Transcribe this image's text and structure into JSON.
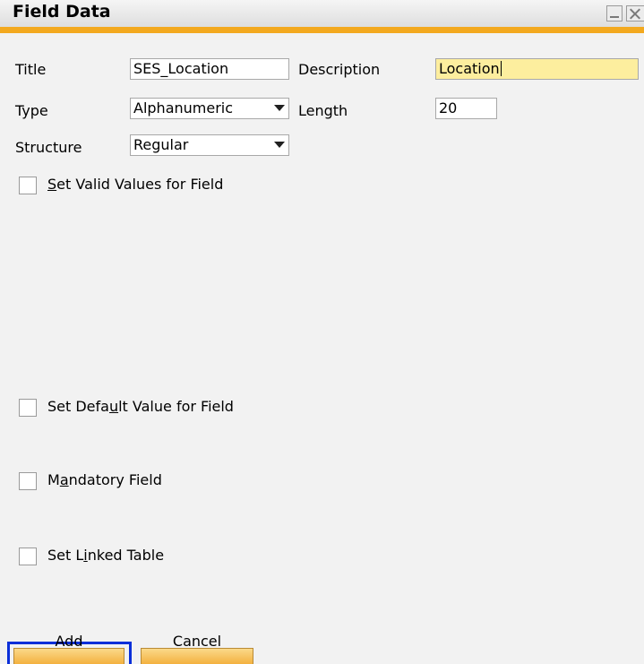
{
  "window": {
    "title": "Field Data",
    "accent_color": "#f3a91f"
  },
  "form": {
    "title_label": "Title",
    "title_value": "SES_Location",
    "description_label": "Description",
    "description_value": "Location",
    "type_label": "Type",
    "type_value": "Alphanumeric",
    "length_label": "Length",
    "length_value": "20",
    "structure_label": "Structure",
    "structure_value": "Regular"
  },
  "options": {
    "valid_values": {
      "pre": "",
      "mnemonic": "S",
      "post": "et Valid Values for Field",
      "checked": false
    },
    "default_value": {
      "pre": "Set Defa",
      "mnemonic": "u",
      "post": "lt Value for Field",
      "checked": false
    },
    "mandatory": {
      "pre": "M",
      "mnemonic": "a",
      "post": "ndatory Field",
      "checked": false
    },
    "linked_table": {
      "pre": "Set L",
      "mnemonic": "i",
      "post": "nked Table",
      "checked": false
    }
  },
  "buttons": {
    "add_label": "Add",
    "cancel_label": "Cancel"
  },
  "icons": {
    "minimize": "minimize-icon",
    "close": "close-icon",
    "dropdown": "chevron-down-icon"
  }
}
